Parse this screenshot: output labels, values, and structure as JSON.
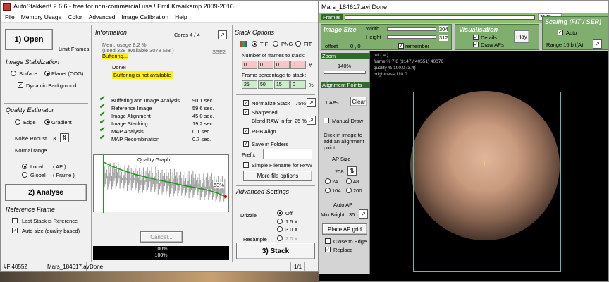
{
  "left": {
    "title": "AutoStakkert! 2.6.6 - free for non-commercial use ! Emil Kraaikamp 2009-2016",
    "menu": [
      "File",
      "Memory Usage",
      "Color",
      "Advanced",
      "Image Calibration",
      "Help"
    ],
    "open_label": "1) Open",
    "limit_frames": "Limit Frames",
    "image_stabilization": {
      "title": "Image Stabilization",
      "surface": "Surface",
      "planet": "Planet (COG)",
      "dynamic_bg": "Dynamic Background"
    },
    "quality": {
      "title": "Quality Estimator",
      "edge": "Edge",
      "gradient": "Gradient",
      "noise_robust": "Noise Robust",
      "noise_value": "3",
      "normal_range": "Normal range",
      "local": "Local",
      "local_ap": "( AP )",
      "global": "Global",
      "global_frame": "( Frame )"
    },
    "analyse_label": "2) Analyse",
    "reference": {
      "title": "Reference Frame",
      "last_stack": "Last Stack is Reference",
      "auto_size": "Auto size (quality based)"
    },
    "info": {
      "title": "Information",
      "cores": "Cores 4 / 4",
      "mem1": "Mem. usage 8.2 %",
      "mem2": "(used 328 available 3078 MB )",
      "buffering": "Buffering...",
      "sse": "SSE2",
      "done": "Done!",
      "buffer_na": "Buffering is not available",
      "timings": [
        {
          "label": "Buffering and Image Analysis",
          "value": "90.1 sec."
        },
        {
          "label": "Reference Image",
          "value": "59.6 sec."
        },
        {
          "label": "Image Alignment",
          "value": "45.0 sec."
        },
        {
          "label": "Image Stacking",
          "value": "19.2 sec."
        },
        {
          "label": "MAP Analysis",
          "value": "0.1 sec."
        },
        {
          "label": "MAP Recombination",
          "value": "0.7 sec."
        }
      ],
      "graph_title": "Quality Graph",
      "graph_pct": "53%",
      "cancel": "Cancel...",
      "prog1": "100%",
      "prog2": "100%"
    },
    "stack": {
      "title": "Stack Options",
      "tif": "TIF",
      "png": "PNG",
      "fit": "FIT",
      "frames_label": "Number of frames to stack:",
      "frames_vals": [
        "0",
        "0",
        "0",
        "0"
      ],
      "frames_unit": "#",
      "pct_label": "Frame percentage to stack:",
      "pct_vals": [
        "25",
        "50",
        "15",
        "0"
      ],
      "pct_unit": "%",
      "normalize": "Normalize Stack",
      "normalize_val": "75%",
      "sharpened": "Sharpened",
      "blend": "Blend RAW in for",
      "blend_val": "25 %",
      "rgb_align": "RGB Align",
      "save_folders": "Save in Folders",
      "prefix": "Prefix",
      "simple_filename": "Simple Filename for RAW",
      "more": "More file options"
    },
    "advanced": {
      "title": "Advanced Settings",
      "drizzle": "Drizzle",
      "off": "Off",
      "x15": "1.5 X",
      "x30": "3.0 X",
      "resample": "Resample",
      "x20": "2.0 X",
      "stack_btn": "3) Stack"
    },
    "status": {
      "frames": "#F 40552",
      "file": "Mars_184617.avi",
      "state": "Done",
      "page": "1/1"
    }
  },
  "right": {
    "title": "Mars_184617.avi   Done",
    "frames_tab": "Frames",
    "frame_num": "2147",
    "image_size": {
      "title": "Image Size",
      "width_label": "Width",
      "width": "304",
      "height_label": "Height",
      "height": "312",
      "offset": "offset",
      "offset_val": "0 , 0",
      "remember": "remember"
    },
    "visualisation": {
      "title": "Visualisation",
      "details": "Details",
      "draw_aps": "Draw APs",
      "play": "Play"
    },
    "scaling": {
      "title": "Scaling (FIT / SER)",
      "auto": "Auto",
      "range": "Range 16 bit(A)"
    },
    "zoom": {
      "title": "Zoom",
      "value": "140%"
    },
    "ap": {
      "title": "Alignment Points",
      "count": "1 APs",
      "clear": "Clear",
      "manual": "Manual Draw",
      "hint": "Click in image to add an alignment point",
      "ap_size": "AP Size",
      "size_val": "208",
      "opts": [
        "24",
        "48",
        "104",
        "200"
      ],
      "auto_ap": "Auto AP",
      "min_bright": "Min Bright",
      "min_val": "35",
      "place": "Place AP grid",
      "close_edge": "Close to Edge",
      "replace": "Replace"
    },
    "overlay": [
      "ref ( a )",
      "frame % 7.8 (3147 / 40551) 40076",
      "quality % 100.0 (3.4)",
      "brightness 110.0"
    ],
    "colors": {
      "frames_bar": "#8fbf6f",
      "panel": "#7fae6f",
      "box": "#5fb7b7"
    }
  },
  "chart_data": {
    "type": "line",
    "title": "Quality Graph",
    "series": [
      {
        "values": [
          100,
          92,
          86,
          80,
          75,
          71,
          67,
          63,
          60,
          57,
          53,
          50,
          47,
          44,
          40,
          35,
          28
        ]
      }
    ]
  }
}
